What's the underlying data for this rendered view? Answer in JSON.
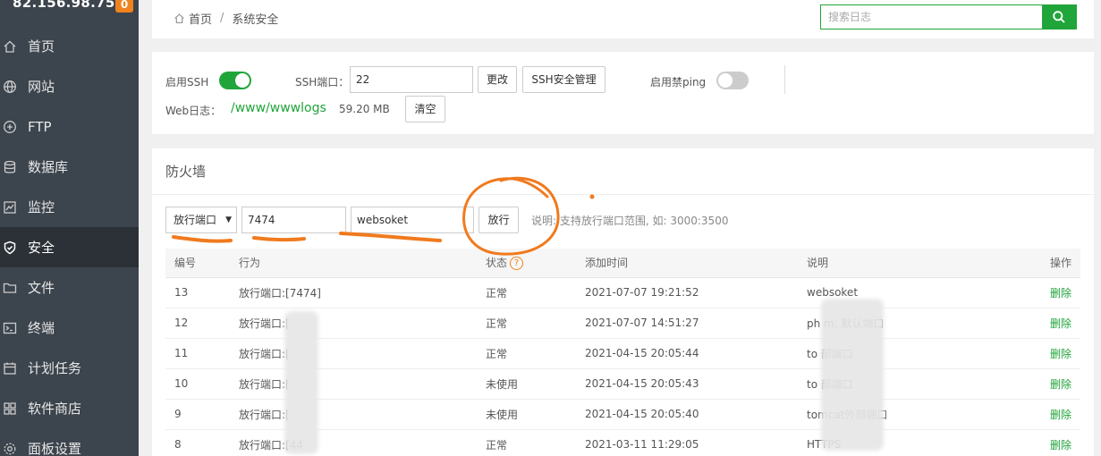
{
  "sidebar": {
    "ip": "82.156.98.75",
    "badge": "0",
    "items": [
      {
        "label": "首页",
        "icon": "home-icon"
      },
      {
        "label": "网站",
        "icon": "globe-icon"
      },
      {
        "label": "FTP",
        "icon": "ftp-icon"
      },
      {
        "label": "数据库",
        "icon": "database-icon"
      },
      {
        "label": "监控",
        "icon": "monitor-icon"
      },
      {
        "label": "安全",
        "icon": "shield-icon"
      },
      {
        "label": "文件",
        "icon": "folder-icon"
      },
      {
        "label": "终端",
        "icon": "terminal-icon"
      },
      {
        "label": "计划任务",
        "icon": "calendar-icon"
      },
      {
        "label": "软件商店",
        "icon": "apps-icon"
      },
      {
        "label": "面板设置",
        "icon": "gear-icon"
      }
    ],
    "active_index": 5
  },
  "breadcrumb": {
    "home": "首页",
    "separator": "/",
    "current": "系统安全"
  },
  "search": {
    "placeholder": "搜索日志"
  },
  "ssh": {
    "enable_label": "启用SSH",
    "enabled": true,
    "port_label": "SSH端口：",
    "port_value": "22",
    "change_button": "更改",
    "manage_button": "SSH安全管理",
    "ping_label": "启用禁ping",
    "ping_enabled": false,
    "weblog_label": "Web日志：",
    "weblog_path": "/www/wwwlogs",
    "weblog_size": "59.20 MB",
    "clear_button": "清空"
  },
  "firewall": {
    "title": "防火墙",
    "type_select": "放行端口",
    "port_value": "7474",
    "desc_value": "websoket",
    "submit_button": "放行",
    "hint": "说明: 支持放行端口范围, 如: 3000:3500",
    "columns": [
      "编号",
      "行为",
      "状态",
      "添加时间",
      "说明",
      "操作"
    ],
    "rows": [
      {
        "id": "13",
        "action": "放行端口:[7474]",
        "status": "正常",
        "time": "2021-07-07 19:21:52",
        "desc": "websoket",
        "op": "删除"
      },
      {
        "id": "12",
        "action": "放行端口:[",
        "status": "正常",
        "time": "2021-07-07 14:51:27",
        "desc": "ph       m. 默认端口",
        "op": "删除"
      },
      {
        "id": "11",
        "action": "放行端口:[",
        "status": "正常",
        "time": "2021-04-15 20:05:44",
        "desc": "to        部端口",
        "op": "删除"
      },
      {
        "id": "10",
        "action": "放行端口:[",
        "status": "未使用",
        "time": "2021-04-15 20:05:43",
        "desc": "to        部端口",
        "op": "删除"
      },
      {
        "id": "9",
        "action": "放行端口:[",
        "status": "未使用",
        "time": "2021-04-15 20:05:40",
        "desc": "tomcat外部端口",
        "op": "删除"
      },
      {
        "id": "8",
        "action": "放行端口:[44",
        "status": "正常",
        "time": "2021-03-11 11:29:05",
        "desc": "HTTPS",
        "op": "删除"
      }
    ]
  },
  "colors": {
    "accent": "#20a53a",
    "sidebar_bg": "#3c444d",
    "sidebar_active": "#2b3136",
    "badge": "#f0831e",
    "annotation": "#f07a1e"
  }
}
